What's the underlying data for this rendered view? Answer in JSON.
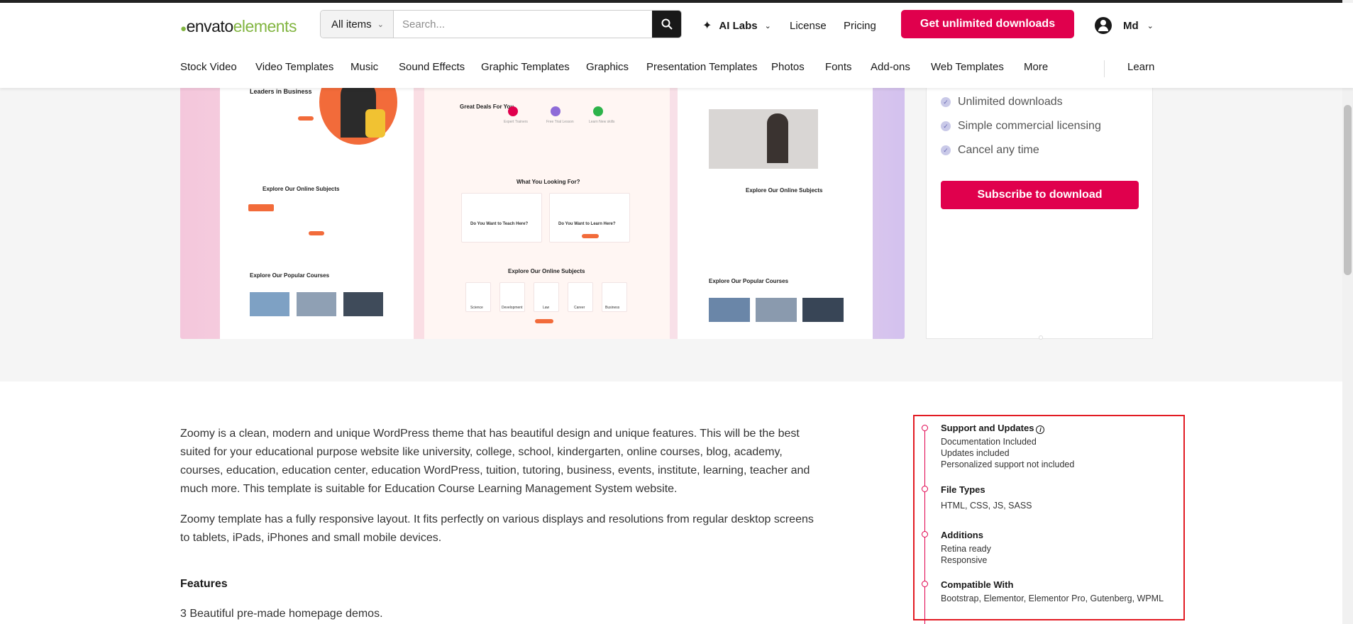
{
  "header": {
    "logo_text": "envato",
    "logo_suffix": "elements",
    "search_category": "All items",
    "search_placeholder": "Search...",
    "ai_labs": "AI Labs",
    "license": "License",
    "pricing": "Pricing",
    "cta": "Get unlimited downloads",
    "user": "Md"
  },
  "nav": {
    "items": [
      "Stock Video",
      "Video Templates",
      "Music",
      "Sound Effects",
      "Graphic Templates",
      "Graphics",
      "Presentation Templates",
      "Photos",
      "Fonts",
      "Add-ons",
      "Web Templates",
      "More"
    ],
    "learn": "Learn"
  },
  "preview": {
    "p1_headline": "Leaders in Business",
    "p1_subjects": "Explore Our Online Subjects",
    "p1_courses": "Explore Our Popular Courses",
    "p2_deals": "Great Deals For You",
    "p2_deal_1": "Expert Trainers",
    "p2_deal_2": "Free Trial Lesson",
    "p2_deal_3": "Learn New skills",
    "p2_looking": "What You Looking For?",
    "p2_teach": "Do You Want to Teach Here?",
    "p2_learn": "Do You Want to Learn Here?",
    "p2_subjects": "Explore Our Online Subjects",
    "p2_sub_1": "Science",
    "p2_sub_2": "Development",
    "p2_sub_3": "Law",
    "p2_sub_4": "Career",
    "p2_sub_5": "Business",
    "p3_subjects": "Explore Our Online Subjects",
    "p3_courses": "Explore Our Popular Courses"
  },
  "sidebar": {
    "benefits": [
      "Unlimited downloads",
      "Simple commercial licensing",
      "Cancel any time"
    ],
    "subscribe": "Subscribe to download"
  },
  "description": {
    "para1": "Zoomy is a clean, modern and unique WordPress theme that has beautiful design and unique features. This will be the best suited for your educational purpose website like university, college, school, kindergarten, online courses, blog, academy, courses, education, education center, education WordPress, tuition, tutoring, business, events, institute, learning, teacher and much more. This template is suitable for Education Course Learning Management System website.",
    "para2": "Zoomy template has a fully responsive layout. It fits perfectly on various displays and resolutions from regular desktop screens to tablets, iPads, iPhones and small mobile devices.",
    "features_heading": "Features",
    "feature_1": "3 Beautiful pre-made homepage demos."
  },
  "attributes": {
    "support_title": "Support and Updates",
    "support_1": "Documentation Included",
    "support_2": "Updates included",
    "support_3": "Personalized support not included",
    "filetypes_title": "File Types",
    "filetypes_val": "HTML, CSS, JS, SASS",
    "additions_title": "Additions",
    "additions_1": "Retina ready",
    "additions_2": "Responsive",
    "compatible_title": "Compatible With",
    "compatible_val": "Bootstrap, Elementor, Elementor Pro, Gutenberg, WPML"
  },
  "colors": {
    "brand_pink": "#e0004d",
    "logo_green": "#82b541",
    "highlight_red": "#e21b23"
  }
}
